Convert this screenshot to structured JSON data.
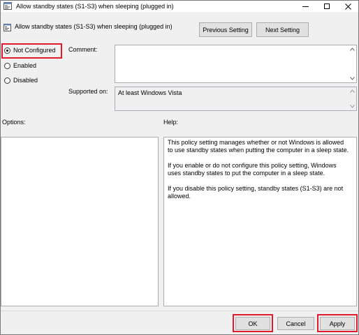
{
  "window": {
    "title": "Allow standby states (S1-S3) when sleeping (plugged in)",
    "icons": {
      "app": "policy-icon",
      "minimize": "minimize-icon",
      "maximize": "maximize-icon",
      "close": "close-icon"
    }
  },
  "header": {
    "title": "Allow standby states (S1-S3) when sleeping (plugged in)",
    "prev_label": "Previous Setting",
    "next_label": "Next Setting"
  },
  "state": {
    "selected": "Not Configured",
    "options": [
      {
        "label": "Not Configured",
        "checked": true
      },
      {
        "label": "Enabled",
        "checked": false
      },
      {
        "label": "Disabled",
        "checked": false
      }
    ],
    "highlight_color": "#e0192b"
  },
  "comment": {
    "label": "Comment:",
    "value": ""
  },
  "supported": {
    "label": "Supported on:",
    "value": "At least Windows Vista"
  },
  "options_pane": {
    "label": "Options:"
  },
  "help_pane": {
    "label": "Help:",
    "paragraphs": [
      "This policy setting manages whether or not Windows is allowed to use standby states when putting the computer in a sleep state.",
      "If you enable or do not configure this policy setting, Windows uses standby states to put the computer in a sleep state.",
      "If you disable this policy setting, standby states (S1-S3) are not allowed."
    ]
  },
  "footer": {
    "ok_label": "OK",
    "cancel_label": "Cancel",
    "apply_label": "Apply"
  }
}
